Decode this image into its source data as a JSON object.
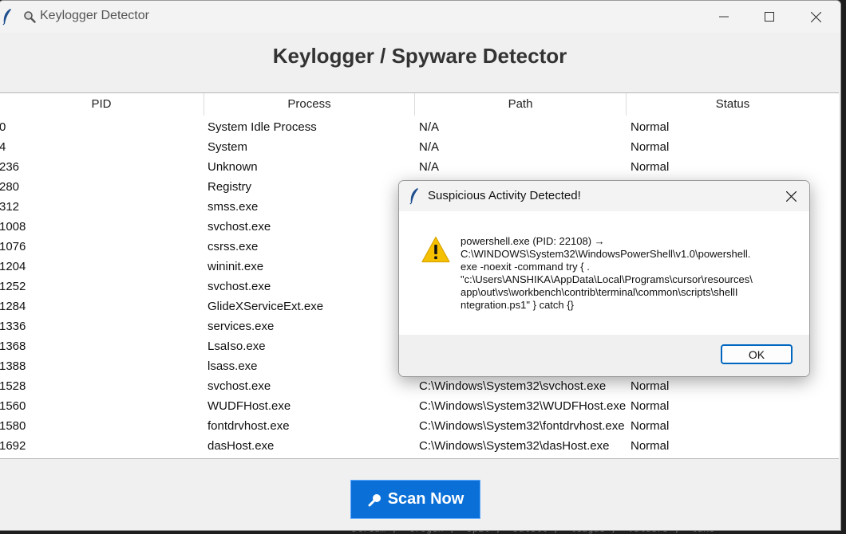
{
  "window": {
    "title": "Keylogger Detector",
    "minimize": "–",
    "maximize": "☐",
    "close": "✕"
  },
  "heading": "Keylogger / Spyware Detector",
  "table": {
    "columns": [
      "PID",
      "Process",
      "Path",
      "Status"
    ],
    "rows": [
      {
        "pid": "0",
        "process": "System Idle Process",
        "path": "N/A",
        "status": "Normal"
      },
      {
        "pid": "4",
        "process": "System",
        "path": "N/A",
        "status": "Normal"
      },
      {
        "pid": "236",
        "process": "Unknown",
        "path": "N/A",
        "status": "Normal"
      },
      {
        "pid": "280",
        "process": "Registry",
        "path": "",
        "status": ""
      },
      {
        "pid": "312",
        "process": "smss.exe",
        "path": "",
        "status": ""
      },
      {
        "pid": "1008",
        "process": "svchost.exe",
        "path": "",
        "status": ""
      },
      {
        "pid": "1076",
        "process": "csrss.exe",
        "path": "",
        "status": ""
      },
      {
        "pid": "1204",
        "process": "wininit.exe",
        "path": "",
        "status": ""
      },
      {
        "pid": "1252",
        "process": "svchost.exe",
        "path": "",
        "status": ""
      },
      {
        "pid": "1284",
        "process": "GlideXServiceExt.exe",
        "path": "",
        "status": ""
      },
      {
        "pid": "1336",
        "process": "services.exe",
        "path": "",
        "status": ""
      },
      {
        "pid": "1368",
        "process": "LsaIso.exe",
        "path": "",
        "status": ""
      },
      {
        "pid": "1388",
        "process": "lsass.exe",
        "path": "",
        "status": ""
      },
      {
        "pid": "1528",
        "process": "svchost.exe",
        "path": "C:\\Windows\\System32\\svchost.exe",
        "status": "Normal"
      },
      {
        "pid": "1560",
        "process": "WUDFHost.exe",
        "path": "C:\\Windows\\System32\\WUDFHost.exe",
        "status": "Normal"
      },
      {
        "pid": "1580",
        "process": "fontdrvhost.exe",
        "path": "C:\\Windows\\System32\\fontdrvhost.exe",
        "status": "Normal"
      },
      {
        "pid": "1692",
        "process": "dasHost.exe",
        "path": "C:\\Windows\\System32\\dasHost.exe",
        "status": "Normal"
      }
    ]
  },
  "scan_button": {
    "label": "Scan Now"
  },
  "dialog": {
    "title": "Suspicious Activity Detected!",
    "close": "✕",
    "message_lines": [
      "powershell.exe (PID: 22108) →",
      "C:\\WINDOWS\\System32\\WindowsPowerShell\\v1.0\\powershell.",
      "exe -noexit -command try { .",
      "\"c:\\Users\\ANSHIKA\\AppData\\Local\\Programs\\cursor\\resources\\",
      "app\\out\\vs\\workbench\\contrib\\terminal\\common\\scripts\\shellI",
      "ntegration.ps1\" } catch {}"
    ],
    "ok_label": "OK"
  },
  "background_terminal": "stream', 'crogen', 'spit', 'satell', 'league', 'valuers', 'take",
  "colors": {
    "accent": "#0a6fd6",
    "warning": "#f5c000",
    "window_bg": "#f0f0f0"
  }
}
